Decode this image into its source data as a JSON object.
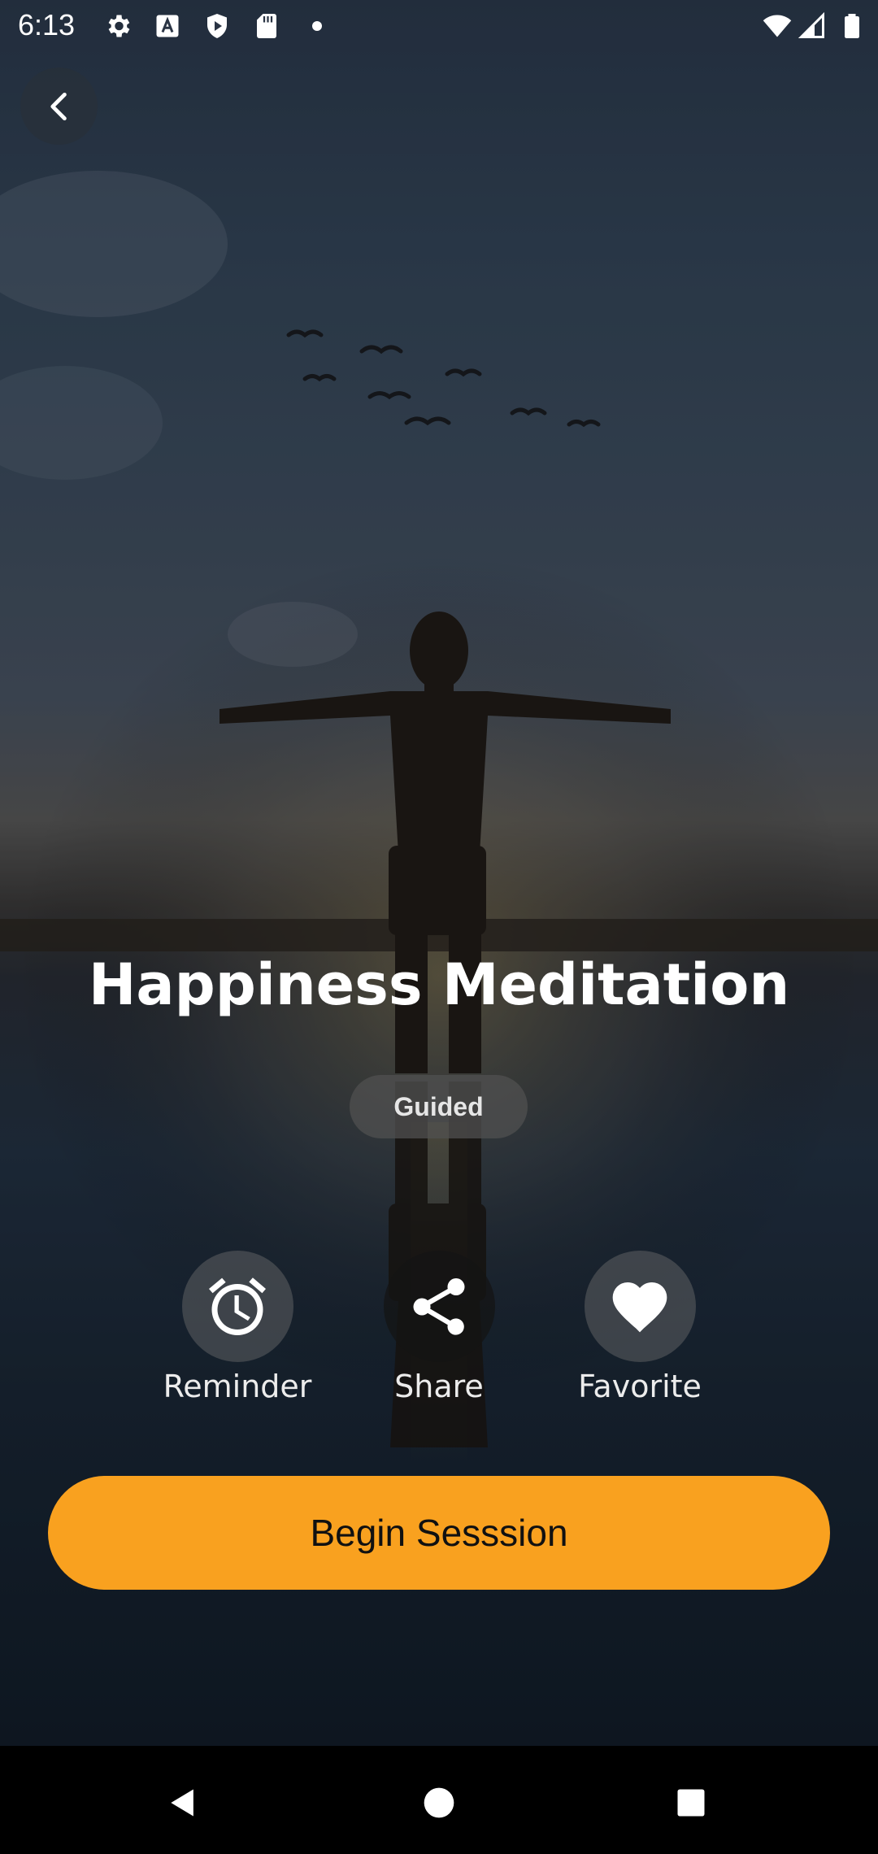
{
  "status_bar": {
    "time": "6:13",
    "left_icons": [
      "settings-icon",
      "accessibility-icon",
      "shield-play-icon",
      "sd-card-icon",
      "notification-dot-icon"
    ],
    "right_icons": [
      "wifi-icon",
      "cell-signal-icon",
      "battery-icon"
    ]
  },
  "header": {
    "back_icon": "chevron-left-icon"
  },
  "session": {
    "title": "Happiness Meditation",
    "tag": "Guided"
  },
  "actions": [
    {
      "label": "Reminder",
      "icon": "alarm-clock-icon"
    },
    {
      "label": "Share",
      "icon": "share-icon"
    },
    {
      "label": "Favorite",
      "icon": "heart-icon"
    }
  ],
  "cta": {
    "label": "Begin Sesssion",
    "color": "#f9a11f"
  },
  "nav_bar": {
    "icons": [
      "back-triangle-icon",
      "home-circle-icon",
      "recents-square-icon"
    ]
  }
}
